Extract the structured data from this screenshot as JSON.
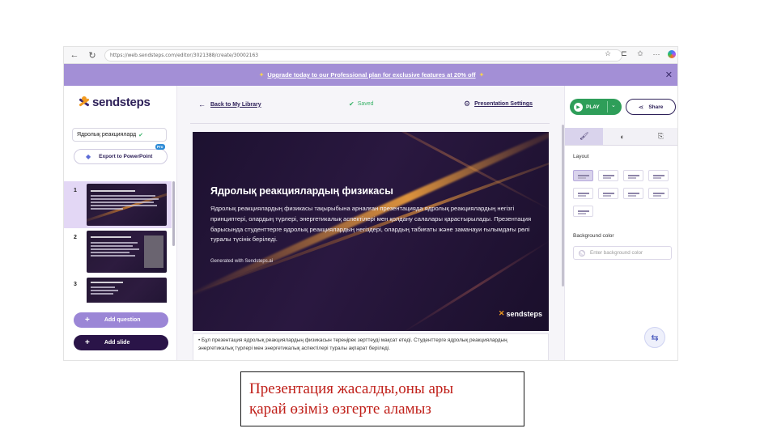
{
  "browser": {
    "url": "https://web.sendsteps.com/editor/3021388/create/30002163",
    "back_icon": "arrow-left-icon",
    "reload_icon": "reload-icon"
  },
  "promo": {
    "text": "Upgrade today to our Professional plan for exclusive features at 20% off",
    "close": "✕",
    "bg_color": "#a38fd6"
  },
  "sidebar": {
    "logo_text": "sendsteps",
    "presentation_title": "Ядролық реакциялард",
    "export_label": "Export to PowerPoint",
    "pro_badge": "Pro",
    "slides": [
      {
        "number": "1",
        "active": true
      },
      {
        "number": "2",
        "active": false
      },
      {
        "number": "3",
        "active": false
      }
    ],
    "add_question_label": "Add question",
    "add_slide_label": "Add slide"
  },
  "editor": {
    "back_label": "Back to My Library",
    "saved_label": "Saved",
    "settings_label": "Presentation Settings",
    "slide": {
      "title": "Ядролық реакциялардың физикасы",
      "body": "Ядролық реакциялардың физикасы тақырыбына арналған презентацияда ядролық реакциялардың негізгі принциптері, олардың түрлері, энергетикалық аспектілері мен қолдану салалары қарастырылады. Презентация барысында студенттерге ядролық реакциялардың негіздері, олардың табиғаты және заманауи ғылымдағы рөлі туралы түсінік беріледі.",
      "credit": "Generated with Sendsteps.ai",
      "logo_text": "sendsteps"
    },
    "notes": "Бұл презентация ядролық реакциялардың физикасын тереңірек зерттеуді мақсат етеді. Студенттерге ядролық реакциялардың энергетикалық түрлері мен энергетикалық аспектілері туралы ақпарат беріледі."
  },
  "right_panel": {
    "play_label": "PLAY",
    "share_label": "Share",
    "tabs": [
      {
        "icon": "brush-icon",
        "glyph": "🖌",
        "active": true
      },
      {
        "icon": "contrast-icon",
        "glyph": "◐",
        "active": false
      },
      {
        "icon": "slide-exit-icon",
        "glyph": "⎘",
        "active": false
      }
    ],
    "layout_label": "Layout",
    "background_label": "Background color",
    "background_placeholder": "Enter background color",
    "accent_color": "#2e9e59"
  },
  "caption": {
    "line1": "Презентация жасалды,оны ары",
    "line2": "қарай өзіміз өзгерте аламыз",
    "color": "#c0201a"
  }
}
